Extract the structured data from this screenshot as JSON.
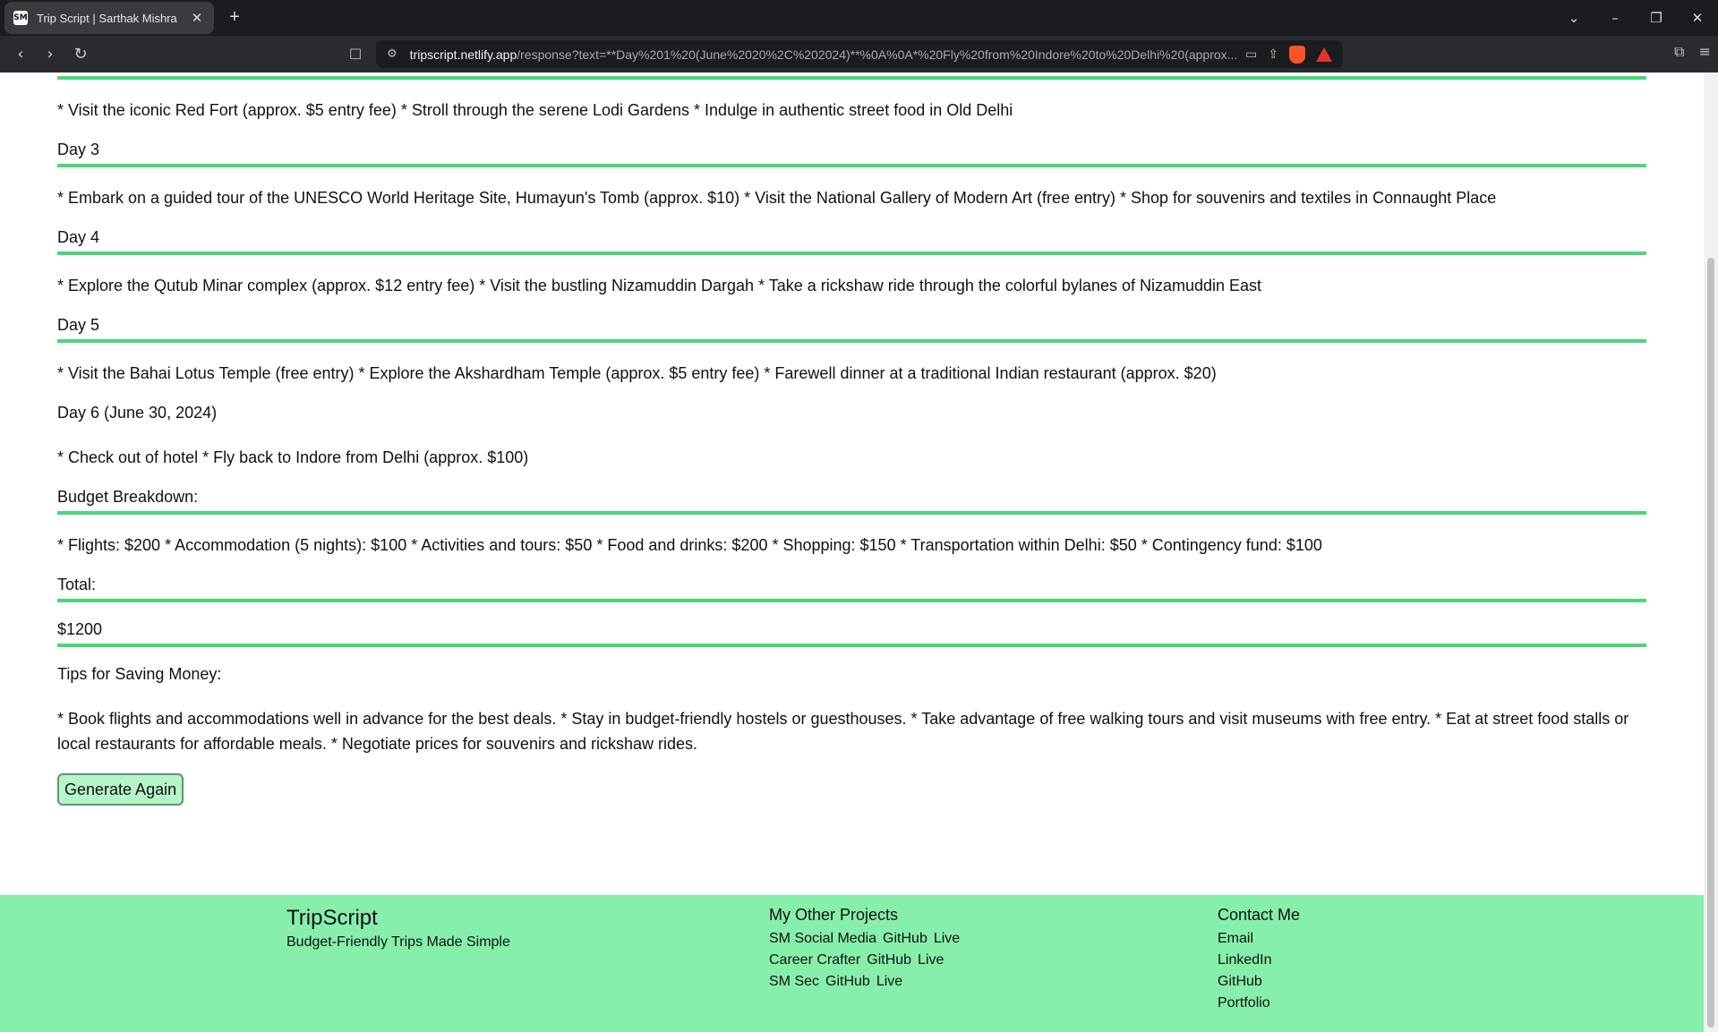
{
  "browser": {
    "tab_title": "Trip Script | Sarthak Mishra",
    "favicon_text": "SM",
    "url_domain": "tripscript.netlify.app",
    "url_path": "/response?text=**Day%201%20(June%2020%2C%202024)**%0A%0A*%20Fly%20from%20Indore%20to%20Delhi%20(approx..."
  },
  "itinerary": {
    "day2_items": "* Visit the iconic Red Fort (approx. $5 entry fee) * Stroll through the serene Lodi Gardens * Indulge in authentic street food in Old Delhi",
    "day3_heading": "Day 3",
    "day3_items": "* Embark on a guided tour of the UNESCO World Heritage Site, Humayun's Tomb (approx. $10) * Visit the National Gallery of Modern Art (free entry) * Shop for souvenirs and textiles in Connaught Place",
    "day4_heading": "Day 4",
    "day4_items": "* Explore the Qutub Minar complex (approx. $12 entry fee) * Visit the bustling Nizamuddin Dargah * Take a rickshaw ride through the colorful bylanes of Nizamuddin East",
    "day5_heading": "Day 5",
    "day5_items": "* Visit the Bahai Lotus Temple (free entry) * Explore the Akshardham Temple (approx. $5 entry fee) * Farewell dinner at a traditional Indian restaurant (approx. $20)",
    "day6_heading": "Day 6 (June 30, 2024)",
    "day6_items": "* Check out of hotel * Fly back to Indore from Delhi (approx. $100)",
    "budget_heading": "Budget Breakdown:",
    "budget_items": "* Flights: $200 * Accommodation (5 nights): $100 * Activities and tours: $50 * Food and drinks: $200 * Shopping: $150 * Transportation within Delhi: $50 * Contingency fund: $100",
    "total_heading": "Total:",
    "total_value": "$1200",
    "tips_heading": "Tips for Saving Money:",
    "tips_items": "* Book flights and accommodations well in advance for the best deals. * Stay in budget-friendly hostels or guesthouses. * Take advantage of free walking tours and visit museums with free entry. * Eat at street food stalls or local restaurants for affordable meals. * Negotiate prices for souvenirs and rickshaw rides."
  },
  "actions": {
    "generate_again": "Generate Again"
  },
  "footer": {
    "brand": "TripScript",
    "tagline": "Budget-Friendly Trips Made Simple",
    "projects_title": "My Other Projects",
    "projects": [
      {
        "name": "SM Social Media",
        "github": "GitHub",
        "live": "Live"
      },
      {
        "name": "Career Crafter",
        "github": "GitHub",
        "live": "Live"
      },
      {
        "name": "SM Sec",
        "github": "GitHub",
        "live": "Live"
      }
    ],
    "contact_title": "Contact Me",
    "contact": [
      "Email",
      "LinkedIn",
      "GitHub",
      "Portfolio"
    ]
  },
  "colors": {
    "accent_line": "#4ad67b",
    "footer_bg": "#86efac",
    "button_bg": "#b6f5c9"
  }
}
